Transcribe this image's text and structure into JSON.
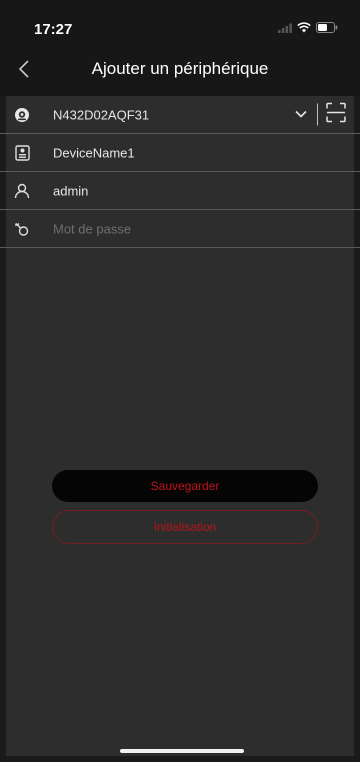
{
  "status_bar": {
    "time": "17:27",
    "icons": [
      "signal-icon",
      "wifi-icon",
      "battery-icon"
    ]
  },
  "nav": {
    "title": "Ajouter un périphérique",
    "back_icon": "chevron-left-icon"
  },
  "form": {
    "serial": {
      "value": "N432D02AQF31",
      "icon": "device-serial-icon",
      "dropdown_icon": "chevron-down-icon",
      "scan_icon": "scan-icon"
    },
    "device_name": {
      "value": "DeviceName1",
      "icon": "device-name-icon"
    },
    "username": {
      "value": "admin",
      "icon": "user-icon"
    },
    "password": {
      "value": "",
      "placeholder": "Mot de passe",
      "icon": "key-icon"
    }
  },
  "buttons": {
    "save_label": "Sauvegarder",
    "init_label": "Initialisation"
  },
  "colors": {
    "background": "#2d2d2d",
    "header": "#171717",
    "accent": "#c0141c",
    "divider": "#5b5b5b"
  }
}
